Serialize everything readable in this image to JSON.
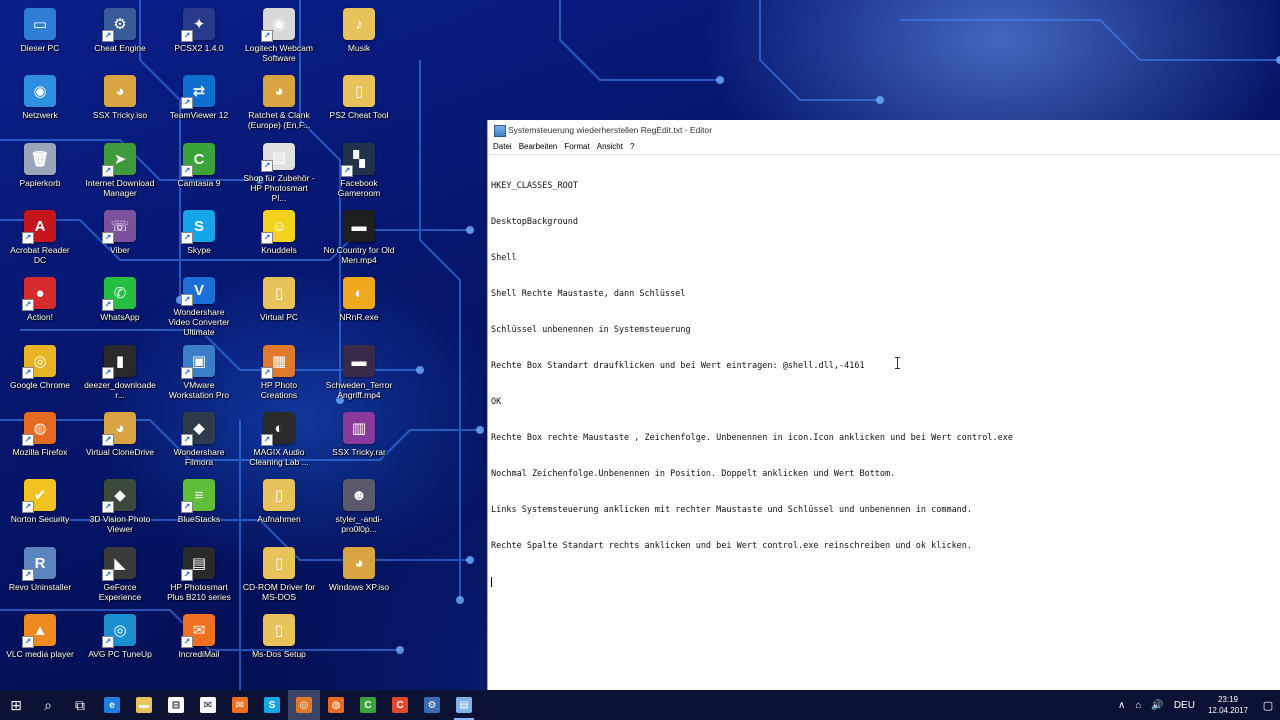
{
  "desktop": {
    "icons": [
      {
        "label": "Dieser PC",
        "icon": "monitor-icon",
        "color": "#2e7fd8",
        "glyph": "▭",
        "short": false
      },
      {
        "label": "Netzwerk",
        "icon": "network-icon",
        "color": "#2e8fe0",
        "glyph": "◉",
        "short": false
      },
      {
        "label": "Papierkorb",
        "icon": "recycle-bin-icon",
        "color": "#9aa6b8",
        "glyph": "🗑",
        "short": false
      },
      {
        "label": "Acrobat Reader DC",
        "icon": "acrobat-icon",
        "color": "#c4161c",
        "glyph": "A",
        "short": true
      },
      {
        "label": "Action!",
        "icon": "action-icon",
        "color": "#d62b2b",
        "glyph": "●",
        "short": true
      },
      {
        "label": "Google Chrome",
        "icon": "chrome-icon",
        "color": "#e8b424",
        "glyph": "◎",
        "short": true
      },
      {
        "label": "Mozilla Firefox",
        "icon": "firefox-icon",
        "color": "#e66a1f",
        "glyph": "◍",
        "short": true
      },
      {
        "label": "Norton Security",
        "icon": "norton-icon",
        "color": "#f2c320",
        "glyph": "✔",
        "short": true
      },
      {
        "label": "Revo Uninstaller",
        "icon": "revo-icon",
        "color": "#5a86c0",
        "glyph": "R",
        "short": true
      },
      {
        "label": "VLC media player",
        "icon": "vlc-icon",
        "color": "#f08a1c",
        "glyph": "▲",
        "short": true
      },
      {
        "label": "Cheat Engine",
        "icon": "cheat-engine-icon",
        "color": "#3a5b9a",
        "glyph": "⚙",
        "short": true
      },
      {
        "label": "SSX Tricky.iso",
        "icon": "disc-image-icon",
        "color": "#d9a441",
        "glyph": "◕",
        "short": false
      },
      {
        "label": "Internet Download Manager",
        "icon": "idm-icon",
        "color": "#3f9a3b",
        "glyph": "➤",
        "short": true
      },
      {
        "label": "Viber",
        "icon": "viber-icon",
        "color": "#7b519d",
        "glyph": "☏",
        "short": true
      },
      {
        "label": "WhatsApp",
        "icon": "whatsapp-icon",
        "color": "#25c040",
        "glyph": "✆",
        "short": true
      },
      {
        "label": "deezer_downloader...",
        "icon": "deezer-icon",
        "color": "#2a2a2a",
        "glyph": "▮",
        "short": true
      },
      {
        "label": "Virtual CloneDrive",
        "icon": "clonedrive-icon",
        "color": "#d9a441",
        "glyph": "◕",
        "short": true
      },
      {
        "label": "3D Vision Photo Viewer",
        "icon": "3d-vision-icon",
        "color": "#3c4a3c",
        "glyph": "◆",
        "short": true
      },
      {
        "label": "GeForce Experience",
        "icon": "geforce-icon",
        "color": "#3a3a3a",
        "glyph": "◣",
        "short": true
      },
      {
        "label": "AVG PC TuneUp",
        "icon": "avg-tuneup-icon",
        "color": "#1a8fd0",
        "glyph": "◎",
        "short": true
      },
      {
        "label": "PCSX2 1.4.0",
        "icon": "pcsx2-icon",
        "color": "#2a3a8a",
        "glyph": "✦",
        "short": true
      },
      {
        "label": "TeamViewer 12",
        "icon": "teamviewer-icon",
        "color": "#0e6fd0",
        "glyph": "⇄",
        "short": true
      },
      {
        "label": "Camtasia 9",
        "icon": "camtasia-icon",
        "color": "#3aa33a",
        "glyph": "C",
        "short": true
      },
      {
        "label": "Skype",
        "icon": "skype-icon",
        "color": "#14a6e8",
        "glyph": "S",
        "short": true
      },
      {
        "label": "Wondershare Video Converter Ultimate",
        "icon": "video-converter-icon",
        "color": "#1c6fd8",
        "glyph": "V",
        "short": true
      },
      {
        "label": "VMware Workstation Pro",
        "icon": "vmware-icon",
        "color": "#3a7ec8",
        "glyph": "▣",
        "short": true
      },
      {
        "label": "Wondershare Filmora",
        "icon": "filmora-icon",
        "color": "#2d3b4a",
        "glyph": "◆",
        "short": true
      },
      {
        "label": "BlueStacks",
        "icon": "bluestacks-icon",
        "color": "#5fbf3a",
        "glyph": "≡",
        "short": true
      },
      {
        "label": "HP Photosmart Plus B210 series",
        "icon": "printer-icon",
        "color": "#2a2a2a",
        "glyph": "▤",
        "short": true
      },
      {
        "label": "IncrediMail",
        "icon": "incredimail-icon",
        "color": "#f07020",
        "glyph": "✉",
        "short": true
      },
      {
        "label": "Logitech Webcam Software",
        "icon": "webcam-icon",
        "color": "#d8d8d8",
        "glyph": "◉",
        "short": true
      },
      {
        "label": "Ratchet & Clank (Europe) (En,F...",
        "icon": "disc-image-icon",
        "color": "#d9a441",
        "glyph": "◕",
        "short": false
      },
      {
        "label": "Shop für Zubehör - HP Photosmart Pl...",
        "icon": "hp-shop-icon",
        "color": "#e0e0e0",
        "glyph": "▤",
        "short": true
      },
      {
        "label": "Knuddels",
        "icon": "knuddels-icon",
        "color": "#f5d01c",
        "glyph": "☺",
        "short": true
      },
      {
        "label": "Virtual PC",
        "icon": "folder-icon",
        "color": "#e8c25a",
        "glyph": "▯",
        "short": false
      },
      {
        "label": "HP Photo Creations",
        "icon": "photo-creations-icon",
        "color": "#e07a2a",
        "glyph": "▦",
        "short": true
      },
      {
        "label": "MAGIX Audio Cleaning Lab ...",
        "icon": "magix-icon",
        "color": "#2a2a2a",
        "glyph": "◐",
        "short": true
      },
      {
        "label": "Aufnahmen",
        "icon": "folder-icon",
        "color": "#e8c25a",
        "glyph": "▯",
        "short": false
      },
      {
        "label": "CD-ROM Driver for MS-DOS",
        "icon": "folder-icon",
        "color": "#e8c25a",
        "glyph": "▯",
        "short": false
      },
      {
        "label": "Ms-Dos Setup",
        "icon": "folder-icon",
        "color": "#e8c25a",
        "glyph": "▯",
        "short": false
      },
      {
        "label": "Musik",
        "icon": "music-folder-icon",
        "color": "#e8c25a",
        "glyph": "♪",
        "short": false
      },
      {
        "label": "PS2 Cheat Tool",
        "icon": "folder-icon",
        "color": "#e8c25a",
        "glyph": "▯",
        "short": false
      },
      {
        "label": "Facebook Gameroom",
        "icon": "gameroom-icon",
        "color": "#22324a",
        "glyph": "▚",
        "short": true
      },
      {
        "label": "No Country for Old Men.mp4",
        "icon": "video-file-icon",
        "color": "#1f1f1f",
        "glyph": "▬",
        "short": false
      },
      {
        "label": "NRnR.exe",
        "icon": "nrnr-icon",
        "color": "#f0a81c",
        "glyph": "◐",
        "short": false
      },
      {
        "label": "Schweden_Terror Angriff.mp4",
        "icon": "video-file-icon",
        "color": "#3a2a4a",
        "glyph": "▬",
        "short": false
      },
      {
        "label": "SSX Tricky.rar",
        "icon": "rar-icon",
        "color": "#8a3a9a",
        "glyph": "▥",
        "short": false
      },
      {
        "label": "styler_-andi-pro0l0p...",
        "icon": "image-file-icon",
        "color": "#5a5a6a",
        "glyph": "☻",
        "short": false
      },
      {
        "label": "Windows XP.iso",
        "icon": "disc-image-icon",
        "color": "#d9a441",
        "glyph": "◕",
        "short": false
      }
    ]
  },
  "notepad": {
    "title": "Systemsteuerung wiederherstellen RegEdit.txt - Editor",
    "menu": [
      "Datei",
      "Bearbeiten",
      "Format",
      "Ansicht",
      "?"
    ],
    "lines": [
      "HKEY_CLASSES_ROOT",
      "DesktopBackground",
      "Shell",
      "Shell Rechte Maustaste, dann Schlüssel",
      "Schlüssel unbenennen in Systemsteuerung",
      "Rechte Box Standart draufklicken und bei Wert eintragen: @shell.dll,-4161",
      "OK",
      "Rechte Box rechte Maustaste , Zeichenfolge. Unbenennen in icon.Icon anklicken und bei Wert control.exe",
      "Nochmal Zeichenfolge.Unbenennen in Position. Doppelt anklicken und Wert Bottom.",
      "Links Systemsteuerung anklicken mit rechter Maustaste und Schlüssel und unbenennen in command.",
      "Rechte Spalte Standart rechts anklicken und bei Wert control.exe reinschreiben und ok klicken."
    ]
  },
  "taskbar": {
    "items": [
      {
        "icon": "start-windows-icon",
        "glyph": "⊞",
        "color": "",
        "state": ""
      },
      {
        "icon": "search-icon",
        "glyph": "⌕",
        "color": "",
        "state": ""
      },
      {
        "icon": "task-view-icon",
        "glyph": "⧉",
        "color": "",
        "state": ""
      },
      {
        "icon": "edge-icon",
        "glyph": "e",
        "color": "#1e7fe0",
        "state": ""
      },
      {
        "icon": "file-explorer-icon",
        "glyph": "▬",
        "color": "#e8c25a",
        "state": ""
      },
      {
        "icon": "store-icon",
        "glyph": "⊟",
        "color": "#ffffff",
        "state": ""
      },
      {
        "icon": "mail-icon",
        "glyph": "✉",
        "color": "#ffffff",
        "state": ""
      },
      {
        "icon": "incredimail-icon",
        "glyph": "✉",
        "color": "#f07020",
        "state": ""
      },
      {
        "icon": "skype-icon",
        "glyph": "S",
        "color": "#14a6e8",
        "state": ""
      },
      {
        "icon": "recorder-icon",
        "glyph": "◎",
        "color": "#e07a2a",
        "state": "active"
      },
      {
        "icon": "firefox-icon",
        "glyph": "◍",
        "color": "#e66a1f",
        "state": ""
      },
      {
        "icon": "camtasia-icon",
        "glyph": "C",
        "color": "#3aa33a",
        "state": ""
      },
      {
        "icon": "camtasia-recorder-icon",
        "glyph": "C",
        "color": "#e04a2a",
        "state": ""
      },
      {
        "icon": "cheat-engine-icon",
        "glyph": "⚙",
        "color": "#3a6bb0",
        "state": ""
      },
      {
        "icon": "notepad-icon",
        "glyph": "▤",
        "color": "#7fb2e8",
        "state": "run"
      }
    ],
    "tray": {
      "chevron": "∧",
      "network": "⌂",
      "volume": "🔊",
      "language": "DEU",
      "time": "23:19",
      "date": "12.04.2017",
      "notifications": "▢"
    }
  }
}
